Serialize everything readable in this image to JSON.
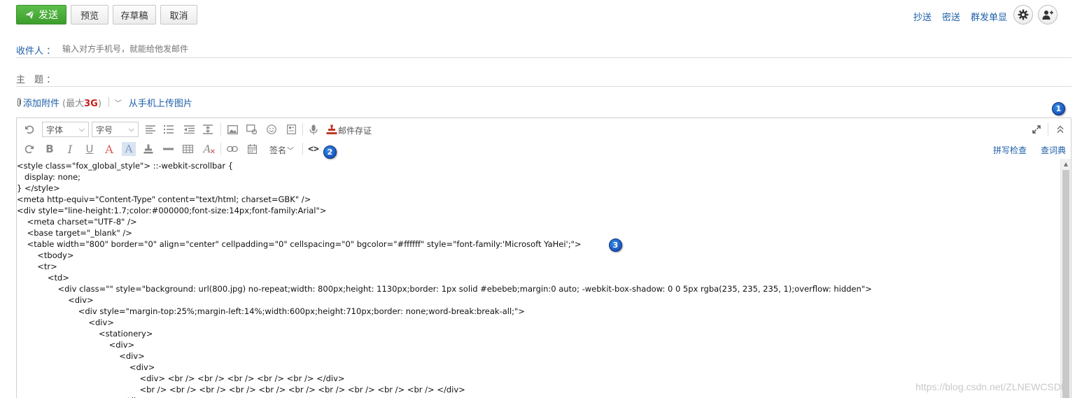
{
  "toolbar": {
    "send": "发送",
    "preview": "预览",
    "save_draft": "存草稿",
    "cancel": "取消",
    "cc": "抄送",
    "bcc": "密送",
    "separate_send": "群发单显"
  },
  "fields": {
    "recipient_label": "收件人 ：",
    "recipient_placeholder": "输入对方手机号，就能给他发邮件",
    "subject_label": "主　题 ：",
    "attach": "添加附件",
    "attach_max_prefix": "(最大",
    "attach_max_value": "3G",
    "attach_max_suffix": ")",
    "upload_phone": "从手机上传图片"
  },
  "editor": {
    "font_select": "字体",
    "size_select": "字号",
    "signature": "签名",
    "evidence": "邮件存证",
    "spell_check": "拼写检查",
    "dictionary": "查词典"
  },
  "code_lines": [
    "<style class=\"fox_global_style\"> ::-webkit-scrollbar {",
    "   display: none;",
    "} </style>",
    "<meta http-equiv=\"Content-Type\" content=\"text/html; charset=GBK\" />",
    "<div style=\"line-height:1.7;color:#000000;font-size:14px;font-family:Arial\">",
    "    <meta charset=\"UTF-8\" />",
    "    <base target=\"_blank\" />",
    "    <table width=\"800\" border=\"0\" align=\"center\" cellpadding=\"0\" cellspacing=\"0\" bgcolor=\"#ffffff\" style=\"font-family:'Microsoft YaHei';\">",
    "        <tbody>",
    "        <tr>",
    "            <td>",
    "                <div class=\"\" style=\"background: url(800.jpg) no-repeat;width: 800px;height: 1130px;border: 1px solid #ebebeb;margin:0 auto; -webkit-box-shadow: 0 0 5px rgba(235, 235, 235, 1);overflow: hidden\">",
    "                    <div>",
    "                        <div style=\"margin-top:25%;margin-left:14%;width:600px;height:710px;border: none;word-break:break-all;\">",
    "                            <div>",
    "                                <stationery>",
    "                                    <div>",
    "                                        <div>",
    "                                            <div>",
    "                                                <div> <br /> <br /> <br /> <br /> <br /> </div>",
    "                                                <br /> <br /> <br /> <br /> <br /> <br /> <br /> <br /> <br /> <br /> </div>",
    "                                        </div>"
  ],
  "badges": [
    "1",
    "2",
    "3"
  ],
  "watermark": "https://blog.csdn.net/ZLNEWCSDN",
  "colors": {
    "send_button": "#3d9d2c",
    "link": "#1d5fa8",
    "badge": "#1a55c8",
    "attach_limit": "#c81e1e"
  }
}
